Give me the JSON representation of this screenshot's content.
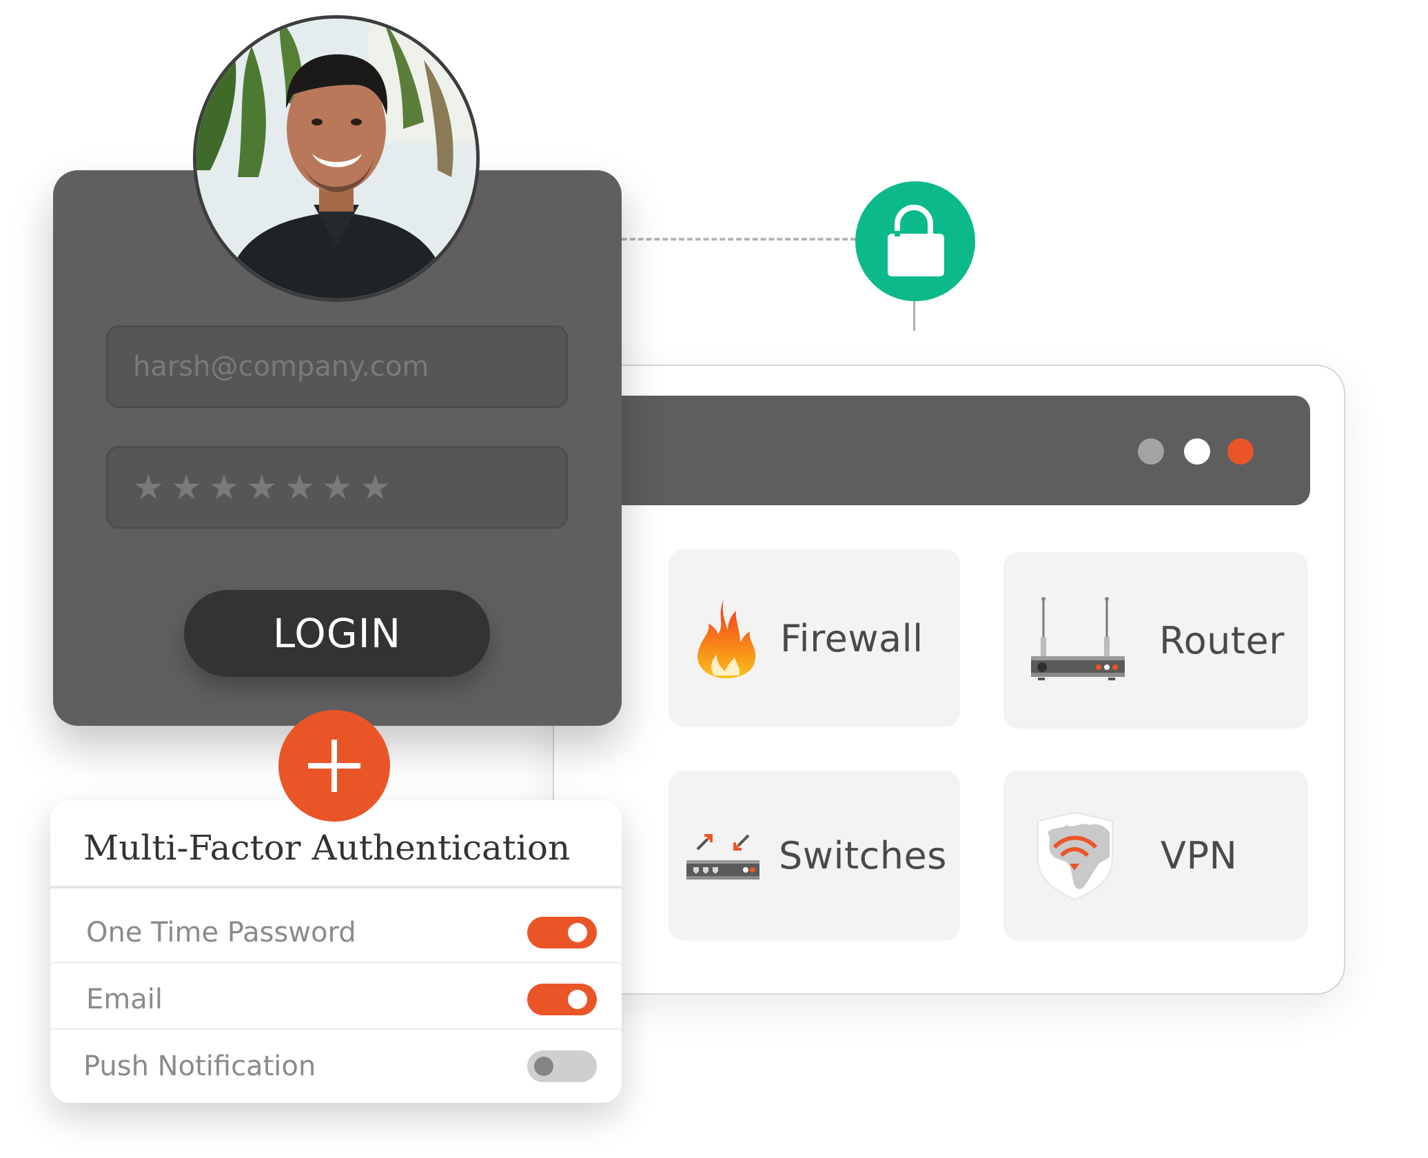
{
  "login": {
    "email_value": "harsh@company.com",
    "password_mask_count": 7,
    "password_mask_char": "★",
    "login_label": "LOGIN"
  },
  "status": {
    "lock_icon": "unlock-icon",
    "lock_color": "#0bb98a"
  },
  "window": {
    "dots": [
      {
        "name": "gray",
        "color": "#a3a3a3"
      },
      {
        "name": "white",
        "color": "#ffffff"
      },
      {
        "name": "orange",
        "color": "#ea5528"
      }
    ],
    "tiles": [
      {
        "label": "Firewall",
        "icon": "firewall-flame-icon"
      },
      {
        "label": "Router",
        "icon": "router-icon"
      },
      {
        "label": "Switches",
        "icon": "switch-icon"
      },
      {
        "label": "VPN",
        "icon": "vpn-shield-globe-icon"
      }
    ]
  },
  "mfa": {
    "add_icon": "plus-icon",
    "title": "Multi-Factor Authentication",
    "options": [
      {
        "label": "One Time Password",
        "enabled": true
      },
      {
        "label": "Email",
        "enabled": true
      },
      {
        "label": "Push Notification",
        "enabled": false
      }
    ]
  },
  "colors": {
    "accent": "#ea5528",
    "success": "#0bb98a",
    "card_dark": "#5f5f5f",
    "button_dark": "#333333"
  }
}
